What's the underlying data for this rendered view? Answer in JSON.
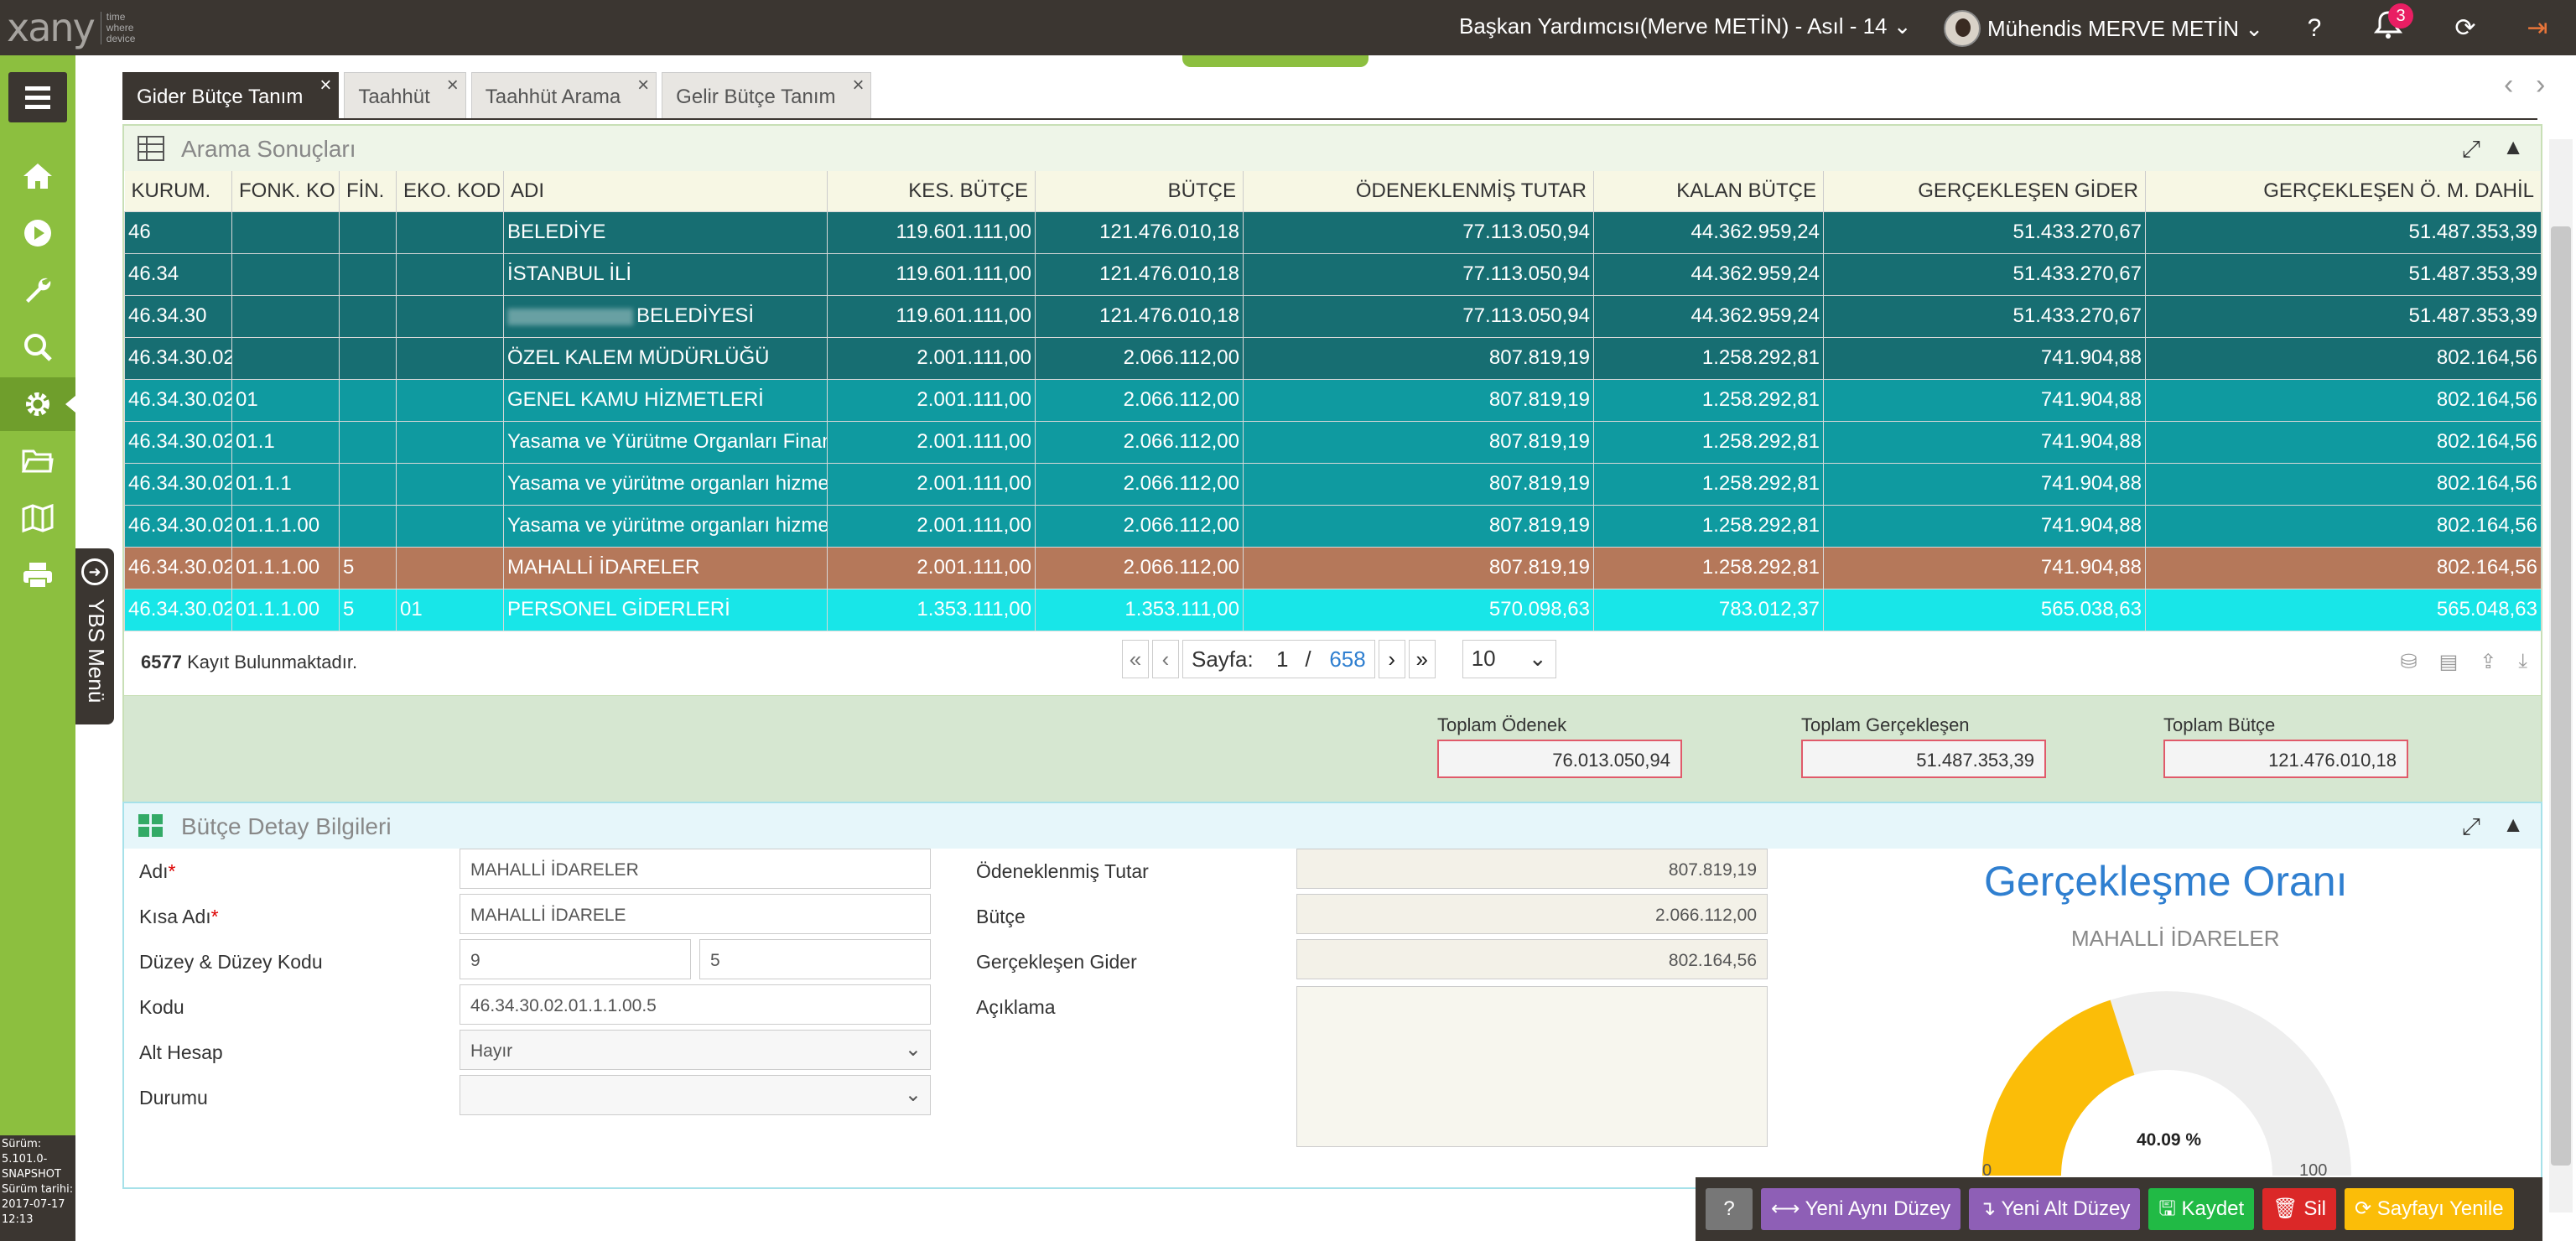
{
  "app": {
    "logo": "xany",
    "logo_tag": [
      "time",
      "where",
      "device"
    ]
  },
  "header": {
    "role": "Başkan Yardımcısı(Merve METİN) - Asıl - 14 ⌄",
    "user": "Mühendis MERVE METİN ⌄",
    "notifications": "3",
    "icons": [
      "help-icon",
      "bell-icon",
      "refresh-icon",
      "logout-icon"
    ]
  },
  "sidebar": {
    "items": [
      "home-icon",
      "play-icon",
      "wrench-icon",
      "search-icon",
      "gear-icon",
      "folder-icon",
      "map-icon",
      "print-icon"
    ],
    "ybs_menu": "YBS Menü",
    "version": [
      "Sürüm:",
      "5.101.0-",
      "SNAPSHOT",
      "Sürüm tarihi:",
      "2017-07-17",
      "12:13"
    ]
  },
  "tabs": [
    "Gider Bütçe Tanım",
    "Taahhüt",
    "Taahhüt Arama",
    "Gelir Bütçe Tanım"
  ],
  "results": {
    "title": "Arama Sonuçları",
    "columns": [
      "KURUM.",
      "FONK. KO",
      "FİN.",
      "EKO. KOD",
      "ADI",
      "KES. BÜTÇE",
      "BÜTÇE",
      "ÖDENEKLENMİŞ TUTAR",
      "KALAN BÜTÇE",
      "GERÇEKLEŞEN GİDER",
      "GERÇEKLEŞEN Ö. M. DAHİL"
    ],
    "rows": [
      [
        "46",
        "",
        "",
        "",
        "BELEDİYE",
        "119.601.111,00",
        "121.476.010,18",
        "77.113.050,94",
        "44.362.959,24",
        "51.433.270,67",
        "51.487.353,39"
      ],
      [
        "46.34",
        "",
        "",
        "",
        "İSTANBUL İLİ",
        "119.601.111,00",
        "121.476.010,18",
        "77.113.050,94",
        "44.362.959,24",
        "51.433.270,67",
        "51.487.353,39"
      ],
      [
        "46.34.30",
        "",
        "",
        "",
        "BELEDİYESİ",
        "119.601.111,00",
        "121.476.010,18",
        "77.113.050,94",
        "44.362.959,24",
        "51.433.270,67",
        "51.487.353,39"
      ],
      [
        "46.34.30.02",
        "",
        "",
        "",
        "ÖZEL KALEM MÜDÜRLÜĞÜ",
        "2.001.111,00",
        "2.066.112,00",
        "807.819,19",
        "1.258.292,81",
        "741.904,88",
        "802.164,56"
      ],
      [
        "46.34.30.02",
        "01",
        "",
        "",
        "GENEL KAMU HİZMETLERİ",
        "2.001.111,00",
        "2.066.112,00",
        "807.819,19",
        "1.258.292,81",
        "741.904,88",
        "802.164,56"
      ],
      [
        "46.34.30.02",
        "01.1",
        "",
        "",
        "Yasama ve Yürütme Organları Finansal",
        "2.001.111,00",
        "2.066.112,00",
        "807.819,19",
        "1.258.292,81",
        "741.904,88",
        "802.164,56"
      ],
      [
        "46.34.30.02",
        "01.1.1",
        "",
        "",
        "Yasama ve yürütme organları hizmetleri",
        "2.001.111,00",
        "2.066.112,00",
        "807.819,19",
        "1.258.292,81",
        "741.904,88",
        "802.164,56"
      ],
      [
        "46.34.30.02",
        "01.1.1.00",
        "",
        "",
        "Yasama ve yürütme organları hizmetleri",
        "2.001.111,00",
        "2.066.112,00",
        "807.819,19",
        "1.258.292,81",
        "741.904,88",
        "802.164,56"
      ],
      [
        "46.34.30.02",
        "01.1.1.00",
        "5",
        "",
        "MAHALLİ İDARELER",
        "2.001.111,00",
        "2.066.112,00",
        "807.819,19",
        "1.258.292,81",
        "741.904,88",
        "802.164,56"
      ],
      [
        "46.34.30.02",
        "01.1.1.00",
        "5",
        "01",
        "PERSONEL GİDERLERİ",
        "1.353.111,00",
        "1.353.111,00",
        "570.098,63",
        "783.012,37",
        "565.038,63",
        "565.048,63"
      ]
    ],
    "row_styles": [
      "lv0",
      "lv0",
      "lv0",
      "lv0",
      "lv1",
      "lv1",
      "lv1",
      "lv1",
      "sel",
      "lv2"
    ],
    "record_count": "6577",
    "record_text": "Kayıt Bulunmaktadır.",
    "pager": {
      "label": "Sayfa:",
      "current": "1",
      "sep": "/",
      "total": "658",
      "page_size": "10"
    },
    "totals": [
      {
        "label": "Toplam Ödenek",
        "value": "76.013.050,94"
      },
      {
        "label": "Toplam Gerçekleşen",
        "value": "51.487.353,39"
      },
      {
        "label": "Toplam Bütçe",
        "value": "121.476.010,18"
      }
    ]
  },
  "detail": {
    "title": "Bütçe Detay Bilgileri",
    "labels": {
      "adi": "Adı",
      "kisa_adi": "Kısa Adı",
      "duzey": "Düzey & Düzey Kodu",
      "kodu": "Kodu",
      "alt_hesap": "Alt Hesap",
      "durumu": "Durumu",
      "odenek": "Ödeneklenmiş Tutar",
      "butce": "Bütçe",
      "gider": "Gerçekleşen Gider",
      "aciklama": "Açıklama"
    },
    "values": {
      "adi": "MAHALLİ İDARELER",
      "kisa_adi": "MAHALLİ İDARELE",
      "duzey": "9",
      "duzey_kodu": "5",
      "kodu": "46.34.30.02.01.1.1.00.5",
      "alt_hesap": "Hayır",
      "durumu": "",
      "odenek": "807.819,19",
      "butce": "2.066.112,00",
      "gider": "802.164,56",
      "aciklama": ""
    }
  },
  "gauge": {
    "title": "Gerçekleşme Oranı",
    "subtitle": "MAHALLİ İDARELER",
    "value": 40.09,
    "label": "40.09 %",
    "min": "0",
    "max": "100",
    "fill_color": "#fbbd08",
    "track_color": "#eeeeee"
  },
  "actions": [
    {
      "label": "?",
      "color": "#777777"
    },
    {
      "label": "⟷ Yeni Aynı Düzey",
      "color": "#8e5fb6"
    },
    {
      "label": "↴ Yeni Alt Düzey",
      "color": "#8e5fb6"
    },
    {
      "label": "🖫 Kaydet",
      "color": "#21ba45"
    },
    {
      "label": "🗑 Sil",
      "color": "#db2828"
    },
    {
      "label": "⟳ Sayfayı Yenile",
      "color": "#fbbd08"
    }
  ]
}
